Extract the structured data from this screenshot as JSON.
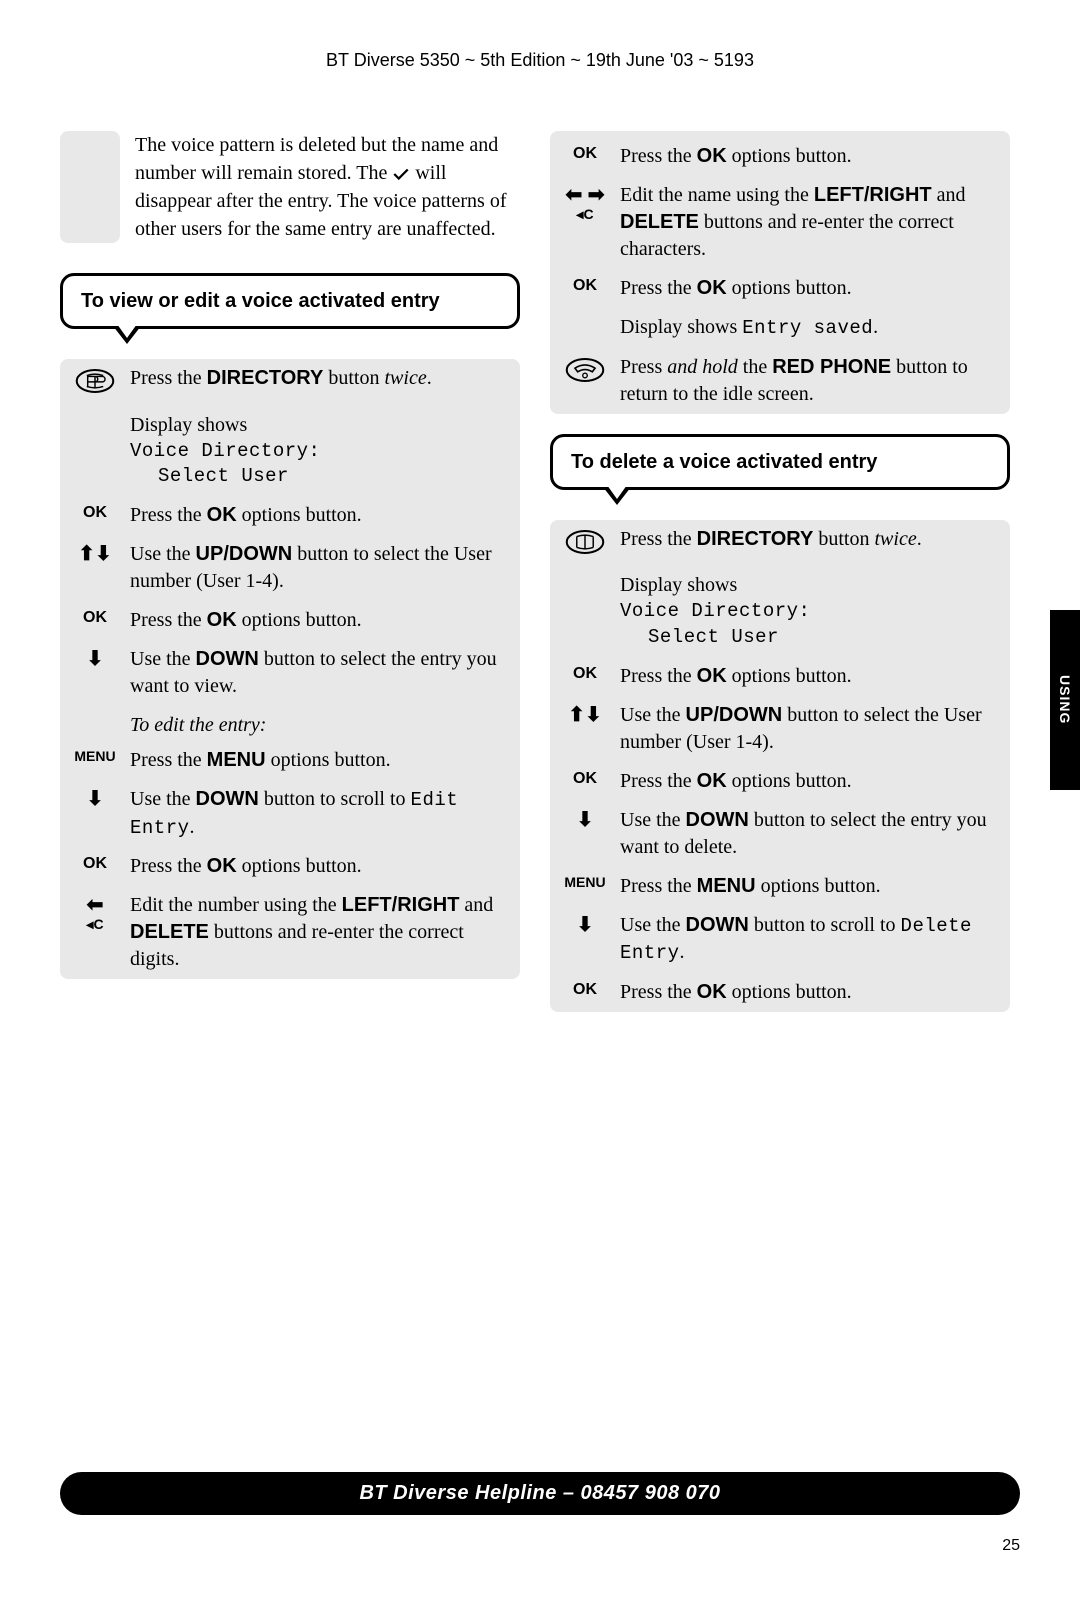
{
  "header": "BT Diverse 5350 ~ 5th Edition ~ 19th June '03 ~ 5193",
  "intro": {
    "pre": "The voice pattern is deleted but the name and number will remain stored. The ",
    "post": " will disappear after the entry. The voice patterns of other users for the same entry are unaffected."
  },
  "callout1": "To view or edit a voice activated entry",
  "callout2": "To delete a voice activated entry",
  "subhead1": "To edit the entry:",
  "left": {
    "s1a": "Press the ",
    "s1b": "DIRECTORY",
    "s1c": " button ",
    "s1d": "twice",
    "s1e": ".",
    "s2a": "Display shows",
    "s2b": "Voice Directory:",
    "s2c": "Select User",
    "s3a": "Press the ",
    "s3b": "OK",
    "s3c": " options button.",
    "s4a": "Use the ",
    "s4b": "UP/DOWN",
    "s4c": " button to select the User number (User 1-4).",
    "s5a": "Press the ",
    "s5b": "OK",
    "s5c": " options button.",
    "s6a": "Use the ",
    "s6b": "DOWN",
    "s6c": " button to select the entry you want to view.",
    "s7a": "Press the ",
    "s7b": "MENU",
    "s7c": " options button.",
    "s8a": "Use the ",
    "s8b": "DOWN",
    "s8c": " button to scroll to ",
    "s8d": "Edit Entry",
    "s8e": ".",
    "s9a": "Press the ",
    "s9b": "OK",
    "s9c": " options button.",
    "s10a": "Edit the number using the ",
    "s10b": "LEFT/RIGHT",
    "s10c": " and ",
    "s10d": "DELETE",
    "s10e": " buttons and re-enter the correct digits."
  },
  "right": {
    "r1a": "Press the ",
    "r1b": "OK",
    "r1c": " options button.",
    "r2a": "Edit the name using the ",
    "r2b": "LEFT/RIGHT",
    "r2c": " and ",
    "r2d": "DELETE",
    "r2e": " buttons and re-enter the correct characters.",
    "r3a": "Press the ",
    "r3b": "OK",
    "r3c": " options button.",
    "r4a": "Display shows ",
    "r4b": "Entry saved",
    "r4c": ".",
    "r5a": "Press ",
    "r5b": "and hold",
    "r5c": " the ",
    "r5d": "RED PHONE",
    "r5e": " button to return to the idle screen.",
    "d1a": "Press the ",
    "d1b": "DIRECTORY",
    "d1c": " button ",
    "d1d": "twice",
    "d1e": ".",
    "d2a": "Display shows",
    "d2b": "Voice Directory:",
    "d2c": "Select User",
    "d3a": "Press the ",
    "d3b": "OK",
    "d3c": " options button.",
    "d4a": "Use the ",
    "d4b": "UP/DOWN",
    "d4c": " button to select the User number (User 1-4).",
    "d5a": "Press the ",
    "d5b": "OK",
    "d5c": " options button.",
    "d6a": "Use the ",
    "d6b": "DOWN",
    "d6c": " button to select the entry you want to delete.",
    "d7a": "Press the ",
    "d7b": "MENU",
    "d7c": " options button.",
    "d8a": "Use the ",
    "d8b": "DOWN",
    "d8c": " button to scroll to ",
    "d8d": "Delete Entry",
    "d8e": ".",
    "d9a": "Press the ",
    "d9b": "OK",
    "d9c": " options button."
  },
  "icons": {
    "ok": "OK",
    "menu": "MENU",
    "deleteC": "◂C"
  },
  "footer": "BT Diverse Helpline – 08457 908 070",
  "sidetab": "USING",
  "pagenum": "25"
}
